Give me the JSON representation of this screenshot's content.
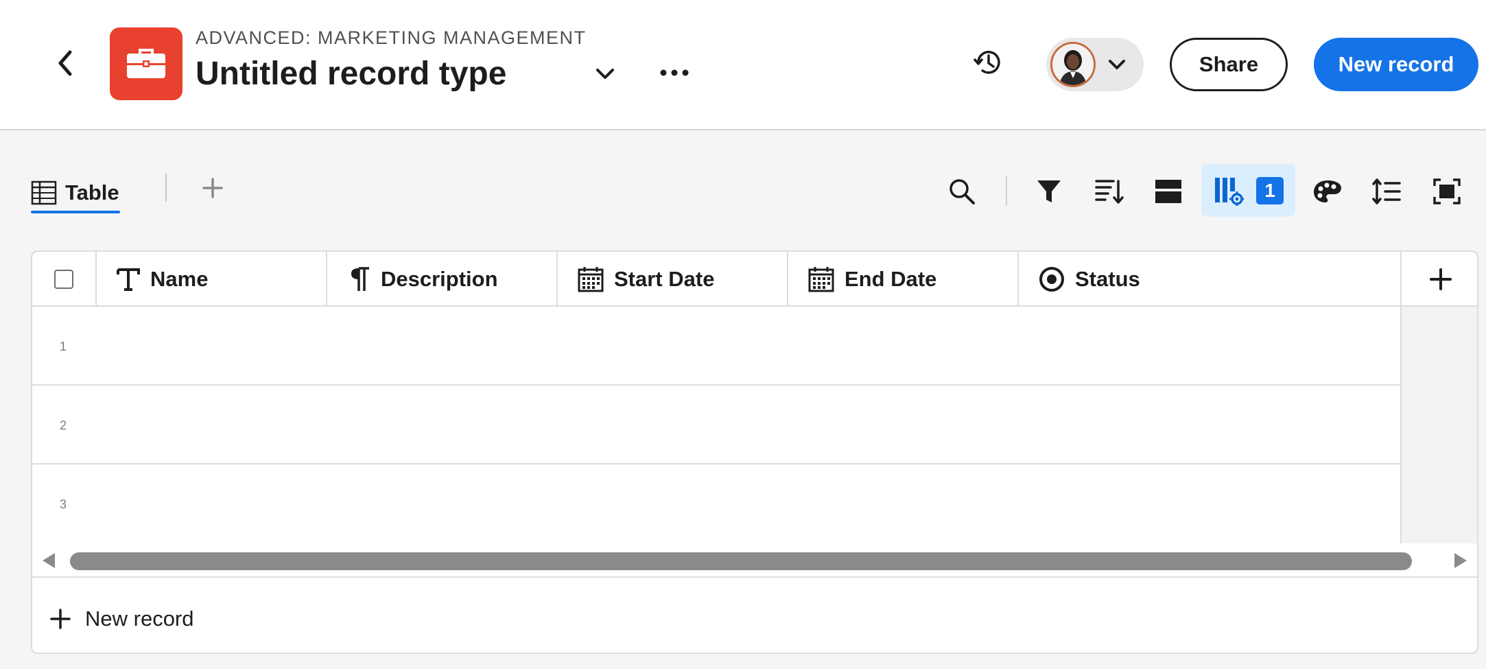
{
  "header": {
    "workspace": "ADVANCED: MARKETING MANAGEMENT",
    "title": "Untitled record type",
    "share_label": "Share",
    "new_record_label": "New record",
    "app_color": "#e8412f",
    "icons": [
      "chevron-left-icon",
      "toolbox-icon",
      "chevron-down-icon",
      "more-icon",
      "history-icon",
      "avatar",
      "chevron-down-icon"
    ]
  },
  "view_bar": {
    "tab_label": "Table",
    "active_field_count": "1",
    "tools": [
      "search-icon",
      "filter-icon",
      "sort-icon",
      "grouping-icon",
      "field-settings-icon",
      "color-palette-icon",
      "row-height-icon",
      "fullscreen-icon"
    ]
  },
  "table": {
    "columns": [
      {
        "label": "Name",
        "icon": "text-type-icon"
      },
      {
        "label": "Description",
        "icon": "paragraph-icon"
      },
      {
        "label": "Start Date",
        "icon": "calendar-icon"
      },
      {
        "label": "End Date",
        "icon": "calendar-icon"
      },
      {
        "label": "Status",
        "icon": "single-select-icon"
      }
    ],
    "rows": [
      "1",
      "2",
      "3"
    ],
    "add_record_label": "New record"
  },
  "colors": {
    "accent": "#1473e6",
    "active_tool_bg": "#dbeefe"
  }
}
